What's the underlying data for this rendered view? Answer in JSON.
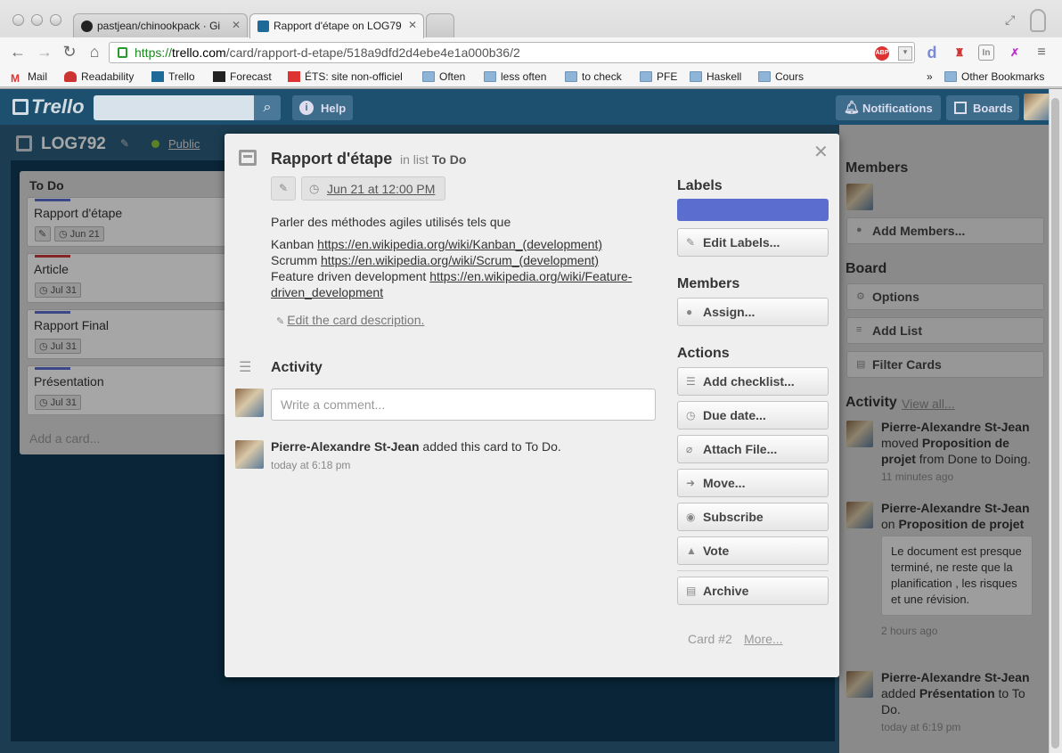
{
  "browser": {
    "tabs": [
      {
        "label": "pastjean/chinookpack · Gi"
      },
      {
        "label": "Rapport d'étape on LOG79"
      }
    ],
    "url_scheme": "https://",
    "url_host": "trello.com",
    "url_path": "/card/rapport-d-etape/518a9dfd2d4ebe4e1a000b36/2",
    "bookmarks": [
      "Mail",
      "Readability",
      "Trello",
      "Forecast",
      "ÉTS: site non-officiel",
      "Often",
      "less often",
      "to check",
      "PFE",
      "Haskell",
      "Cours"
    ],
    "overflow": "»",
    "other_bookmarks": "Other Bookmarks",
    "ext_abp": "ABP"
  },
  "header": {
    "logo": "Trello",
    "help": "Help",
    "notifications": "Notifications",
    "boards": "Boards"
  },
  "board": {
    "name": "LOG792",
    "visibility": "Public",
    "list_title": "To Do",
    "cards": [
      {
        "title": "Rapport d'étape",
        "date": "Jun 21",
        "label_color": "#5b6ed0"
      },
      {
        "title": "Article",
        "date": "Jul 31",
        "label_color": "#c83b3b"
      },
      {
        "title": "Rapport Final",
        "date": "Jul 31",
        "label_color": "#5b6ed0"
      },
      {
        "title": "Présentation",
        "date": "Jul 31",
        "label_color": "#5b6ed0"
      }
    ],
    "add_card": "Add a card..."
  },
  "modal": {
    "title": "Rapport d'étape",
    "in_list_prefix": "in list",
    "in_list_name": "To Do",
    "due": "Jun 21 at 12:00 PM",
    "desc_intro": "Parler des méthodes agiles utilisés tels que",
    "desc_lines": [
      {
        "text": "Kanban",
        "link": "https://en.wikipedia.org/wiki/Kanban_(development)"
      },
      {
        "text": "Scrumm",
        "link": "https://en.wikipedia.org/wiki/Scrum_(development)"
      },
      {
        "text": "Feature driven development",
        "link_a": "https://en.wikipedia.org/wiki/Feature-",
        "link_b": "driven_development"
      }
    ],
    "edit_desc": "Edit the card description.",
    "activity_title": "Activity",
    "comment_placeholder": "Write a comment...",
    "activity_user": "Pierre-Alexandre St-Jean",
    "activity_text": " added this card to To Do.",
    "activity_time": "today at 6:18 pm",
    "labels_title": "Labels",
    "label_color": "#5b6ed0",
    "edit_labels": "Edit Labels...",
    "members_title": "Members",
    "assign": "Assign...",
    "actions_title": "Actions",
    "actions": [
      "Add checklist...",
      "Due date...",
      "Attach File...",
      "Move...",
      "Subscribe",
      "Vote"
    ],
    "archive": "Archive",
    "card_num": "Card #2",
    "more": "More..."
  },
  "sidebar": {
    "members_title": "Members",
    "add_members": "Add Members...",
    "board_title": "Board",
    "options": "Options",
    "add_list": "Add List",
    "filter_cards": "Filter Cards",
    "activity_title": "Activity",
    "view_all": "View all...",
    "items": [
      {
        "user": "Pierre-Alexandre St-Jean",
        "verb": "moved",
        "obj": "Proposition de projet",
        "rest": "from Done to Doing.",
        "time": "11 minutes ago"
      },
      {
        "user": "Pierre-Alexandre St-Jean",
        "verb": "on",
        "obj": "Proposition de projet",
        "comment": "Le document est presque terminé, ne reste que la planification , les risques et une révision.",
        "time": "2 hours ago"
      },
      {
        "user": "Pierre-Alexandre St-Jean",
        "verb": "added",
        "obj": "Présentation",
        "rest": "to To Do.",
        "time": "today at 6:19 pm"
      }
    ]
  }
}
